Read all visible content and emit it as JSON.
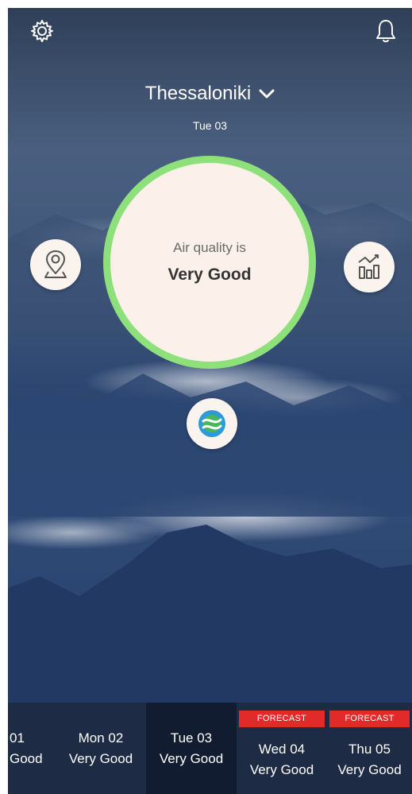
{
  "header": {
    "city": "Thessaloniki",
    "date": "Tue 03"
  },
  "air_quality": {
    "label": "Air quality is",
    "value": "Very Good",
    "ring_color": "#8ee07a"
  },
  "icons": {
    "settings": "gear-icon",
    "notifications": "bell-icon",
    "map": "map-pin-icon",
    "stats": "bar-chart-icon",
    "logo": "app-logo-icon",
    "dropdown": "chevron-down-icon"
  },
  "days": [
    {
      "name": "01",
      "status": "Good",
      "forecast": false,
      "selected": false
    },
    {
      "name": "Mon 02",
      "status": "Very Good",
      "forecast": false,
      "selected": false
    },
    {
      "name": "Tue 03",
      "status": "Very Good",
      "forecast": false,
      "selected": true
    },
    {
      "name": "Wed 04",
      "status": "Very Good",
      "forecast": true,
      "badge": "FORECAST",
      "selected": false
    },
    {
      "name": "Thu 05",
      "status": "Very Good",
      "forecast": true,
      "badge": "FORECAST",
      "selected": false
    }
  ],
  "colors": {
    "forecast_badge": "#e32a2a",
    "bottom_bar": "#1d2b45",
    "selected_day": "#121c30"
  }
}
